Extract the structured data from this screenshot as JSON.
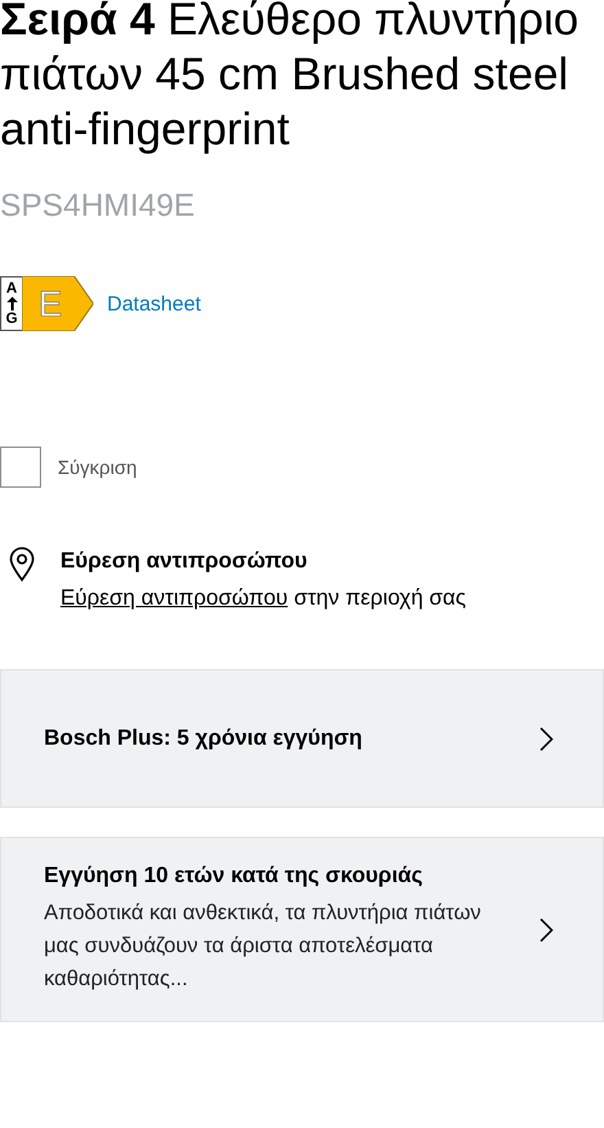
{
  "title": "**Σειρά 4** Ελεύθερο πλυντήριο πιάτων 45 cm Brushed steel anti-fingerprint",
  "model": "SPS4HMI49E",
  "energy_label": {
    "scale_top": "A",
    "scale_bottom": "G",
    "class": "E",
    "link": "Datasheet"
  },
  "compare": {
    "label": "Σύγκριση",
    "checked": false
  },
  "dealer": {
    "heading": "Εύρεση αντιπροσώπου",
    "link": "Εύρεση αντιπροσώπου",
    "text": " στην περιοχή σας"
  },
  "cards": [
    {
      "title": "Bosch Plus: 5 χρόνια εγγύηση"
    },
    {
      "title": "Εγγύηση 10 ετών κατά της σκουριάς",
      "description": "Αποδοτικά και ανθεκτικά, τα πλυντήρια πιάτων μας συνδυάζουν τα άριστα αποτελέσματα καθαριότητας..."
    }
  ]
}
